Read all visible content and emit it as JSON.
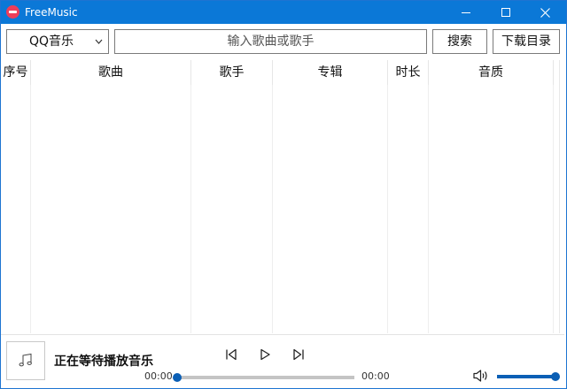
{
  "window": {
    "title": "FreeMusic"
  },
  "toolbar": {
    "source": "QQ音乐",
    "search_placeholder": "输入歌曲或歌手",
    "search_value": "",
    "search_label": "搜索",
    "download_label": "下载目录"
  },
  "table": {
    "columns": [
      "序号",
      "歌曲",
      "歌手",
      "专辑",
      "时长",
      "音质"
    ],
    "rows": []
  },
  "player": {
    "status": "正在等待播放音乐",
    "current_time": "00:00",
    "total_time": "00:00",
    "progress": 0,
    "volume": 1.0
  },
  "colors": {
    "titlebar": "#0b78d7",
    "accent": "#0b5fb5",
    "app_icon": "#ef3d5a"
  },
  "icons": {
    "app": "app-logo-icon",
    "dropdown": "chevron-down-icon",
    "cover": "music-note-icon",
    "prev": "skip-previous-icon",
    "play": "play-icon",
    "next": "skip-next-icon",
    "volume": "speaker-icon"
  }
}
